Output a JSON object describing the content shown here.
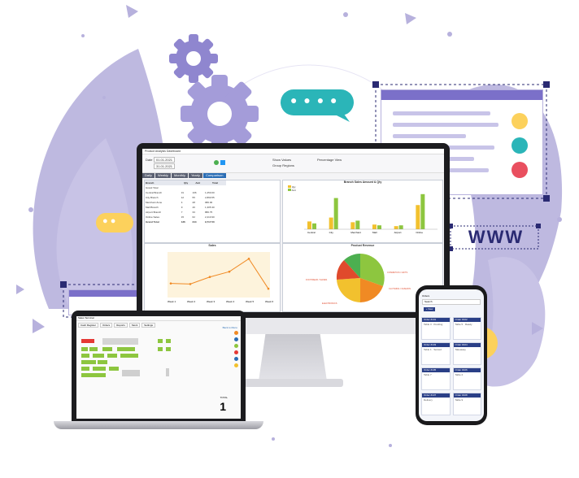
{
  "colors": {
    "lavender": "#b7b1dd",
    "lavender_light": "#dedbf2",
    "purple": "#7b70c9",
    "navy": "#2a2a72",
    "yellow": "#fcd15c",
    "teal": "#2bb5b8",
    "red": "#e94f5f",
    "green": "#8dc63f"
  },
  "decor": {
    "web_label": "WWW",
    "chat_dots": "● ● ● ●",
    "bubble_dots": "● ●"
  },
  "app": {
    "title": "Product Analysis Dashboard",
    "toolbar": {
      "date_label": "Date",
      "date_from": "01.01.2021",
      "date_to": "31.01.2021",
      "option1": "Show Values",
      "option2": "Group Regions",
      "option3": "Percentage View"
    },
    "tabs": [
      "Daily",
      "Weekly",
      "Monthly",
      "Yearly",
      "Comparison"
    ],
    "table": {
      "headers": [
        "Branch",
        "Qty",
        "Amt",
        "Total"
      ],
      "rows": [
        [
          "Grand Total",
          "",
          "",
          ""
        ],
        [
          "Central Branch",
          "31",
          "106",
          "1,250.00"
        ],
        [
          "City Branch",
          "12",
          "55",
          "2,890.55"
        ],
        [
          "Merchant Zone",
          "4",
          "28",
          "980.00"
        ],
        [
          "Mall Branch",
          "9",
          "40",
          "1,305.30"
        ],
        [
          "Airport Branch",
          "7",
          "33",
          "880.75"
        ],
        [
          "Online Sales",
          "15",
          "62",
          "2,410.90"
        ],
        [
          "Grand Total",
          "136",
          "344",
          "9,717.50"
        ]
      ]
    },
    "bar_chart": {
      "title": "Branch Sales Amount & Qty",
      "legend": [
        "Qty",
        "Amt"
      ],
      "categories": [
        "Central",
        "City",
        "Merchant",
        "Mall",
        "Airport",
        "Online"
      ],
      "series": [
        {
          "name": "Qty",
          "values": [
            20,
            30,
            18,
            12,
            8,
            62
          ]
        },
        {
          "name": "Amt",
          "values": [
            15,
            80,
            22,
            10,
            10,
            90
          ]
        }
      ]
    },
    "line_chart": {
      "title": "Sales",
      "categories": [
        "Week 1",
        "Week 2",
        "Week 3",
        "Week 4",
        "Week 5",
        "Week 6"
      ],
      "values": [
        1200,
        1150,
        1750,
        2200,
        3300,
        750
      ]
    },
    "pie_chart": {
      "title": "Product Revenue",
      "labels": [
        "COSMETICS / GIFTS",
        "FOOTWEAR / SHOES",
        "CLOTHING / FASHION",
        "ELECTRONICS"
      ]
    }
  },
  "laptop": {
    "title": "Sales Terminal",
    "tabs": [
      "Cash Register",
      "Orders",
      "Reports",
      "Stock",
      "Settings"
    ],
    "top_link": "Back to Menu",
    "total_label": "TOTAL",
    "total_value": "1"
  },
  "phone": {
    "title": "Orders",
    "search": "Search",
    "add": "+ New",
    "cards": [
      {
        "head": "Order #101",
        "body": "Table 3 · Pending"
      },
      {
        "head": "Order #102",
        "body": "Table 5 · Ready"
      },
      {
        "head": "Order #103",
        "body": "Table 1 · Served"
      },
      {
        "head": "Order #104",
        "body": "Takeaway"
      },
      {
        "head": "Order #105",
        "body": "Table 7"
      },
      {
        "head": "Order #106",
        "body": "Table 2"
      },
      {
        "head": "Order #107",
        "body": "Delivery"
      },
      {
        "head": "Order #108",
        "body": "Table 9"
      }
    ]
  }
}
